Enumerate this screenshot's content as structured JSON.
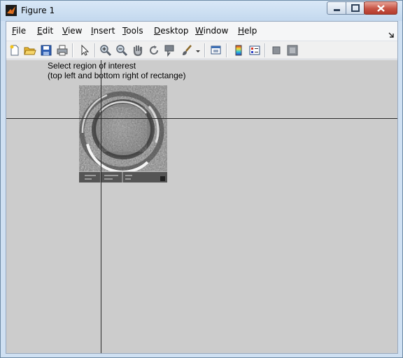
{
  "window": {
    "title": "Figure 1"
  },
  "menu": {
    "items": [
      {
        "label": "File"
      },
      {
        "label": "Edit"
      },
      {
        "label": "View"
      },
      {
        "label": "Insert"
      },
      {
        "label": "Tools"
      },
      {
        "label": "Desktop"
      },
      {
        "label": "Window"
      },
      {
        "label": "Help"
      }
    ]
  },
  "toolbar": {
    "icons": [
      "new-figure-icon",
      "open-file-icon",
      "save-icon",
      "print-icon",
      "edit-plot-icon",
      "zoom-in-icon",
      "zoom-out-icon",
      "pan-icon",
      "rotate-3d-icon",
      "data-cursor-icon",
      "brush-icon",
      "link-plot-icon",
      "colorbar-icon",
      "legend-icon",
      "hide-plot-tools-icon",
      "show-plot-tools-icon"
    ]
  },
  "canvas": {
    "prompt_line1": "Select region of interest",
    "prompt_line2": "(top left and bottom right of rectange)"
  },
  "colors": {
    "canvas_bg": "#cccccc",
    "titlebar": "#c8dcef",
    "crosshair": "#2a2a2a"
  }
}
